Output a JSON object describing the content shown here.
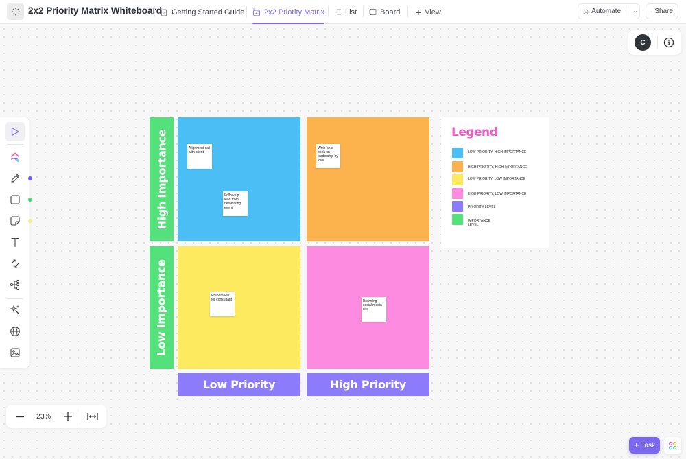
{
  "header": {
    "title": "2x2 Priority Matrix Whiteboard",
    "tabs": [
      {
        "label": "Getting Started Guide",
        "icon": "doc-icon",
        "active": false
      },
      {
        "label": "2x2 Priority Matrix",
        "icon": "whiteboard-icon",
        "active": true
      },
      {
        "label": "List",
        "icon": "list-icon",
        "active": false
      },
      {
        "label": "Board",
        "icon": "board-icon",
        "active": false
      }
    ],
    "add_view_label": "View",
    "automate_label": "Automate",
    "share_label": "Share"
  },
  "presence": {
    "avatar_initial": "C"
  },
  "toolbar": {
    "tools": [
      "select",
      "clickup-ai",
      "pen",
      "shape",
      "sticky-note",
      "text",
      "connector",
      "mind-map",
      "magic",
      "web-embed",
      "image"
    ],
    "color_dots": [
      "#6b5cf0",
      "#4fd97a",
      "#fce68a"
    ]
  },
  "zoom": {
    "level": "23%"
  },
  "matrix": {
    "rows": [
      "High Importance",
      "Low Importance"
    ],
    "columns": [
      "Low Priority",
      "High Priority"
    ],
    "colors": {
      "low_priority_high_importance": "#4bbff5",
      "high_priority_high_importance": "#fdb34d",
      "low_priority_low_importance": "#feea5f",
      "high_priority_low_importance": "#fd8ce0",
      "priority_level": "#8c7bfb",
      "importance_level": "#54e07a"
    },
    "stickies": [
      {
        "text": "Alignment call with client",
        "quadrant": "low_priority_high_importance"
      },
      {
        "text": "Follow up lead from networking event",
        "quadrant": "low_priority_high_importance"
      },
      {
        "text": "Write an e-book on leadership by love",
        "quadrant": "high_priority_high_importance"
      },
      {
        "text": "Prepare PO for consultant",
        "quadrant": "low_priority_low_importance"
      },
      {
        "text": "Browsing social media site",
        "quadrant": "high_priority_low_importance"
      }
    ]
  },
  "legend": {
    "title": "Legend",
    "items": [
      {
        "label": "LOW PRIORITY, HIGH IMPORTANCE",
        "color": "#4bbff5"
      },
      {
        "label": "HIGH PRIORITY, HIGH IMPORTANCE",
        "color": "#fdb34d"
      },
      {
        "label": "LOW PRIORITY, LOW IMPORTANCE",
        "color": "#feea5f"
      },
      {
        "label": "HIGH PRIORITY, LOW IMPORTANCE",
        "color": "#fd8ce0"
      },
      {
        "label": "PRIORITY LEVEL",
        "color": "#8c7bfb"
      },
      {
        "label": "IMPORTANCE LEVEL",
        "color": "#54e07a"
      }
    ]
  },
  "footer": {
    "task_label": "Task"
  }
}
